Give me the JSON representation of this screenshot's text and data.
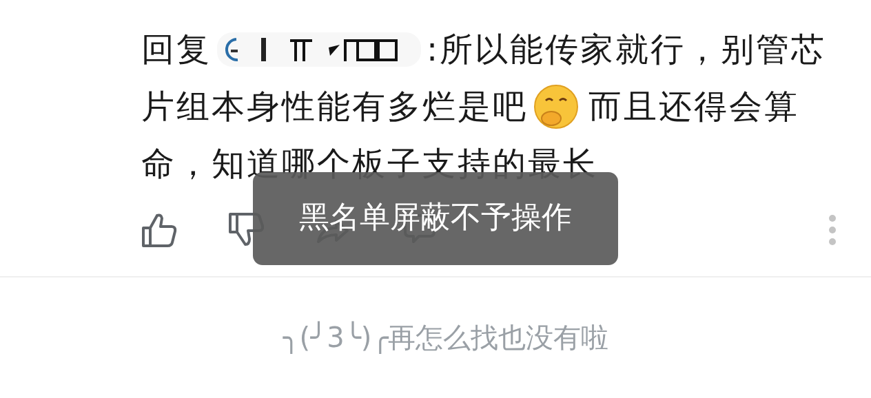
{
  "comment": {
    "reply_prefix": "回复",
    "line_1": ":所以能传家就行，别管芯",
    "line_2_before_emoji": "片组本身性能有多烂是吧",
    "line_2_after_emoji": "而且还得会算",
    "line_3": "命，知道哪个板子支持的最长"
  },
  "toast": {
    "text": "黑名单屏蔽不予操作"
  },
  "end_message": "╮(╯3╰)╭再怎么找也没有啦"
}
